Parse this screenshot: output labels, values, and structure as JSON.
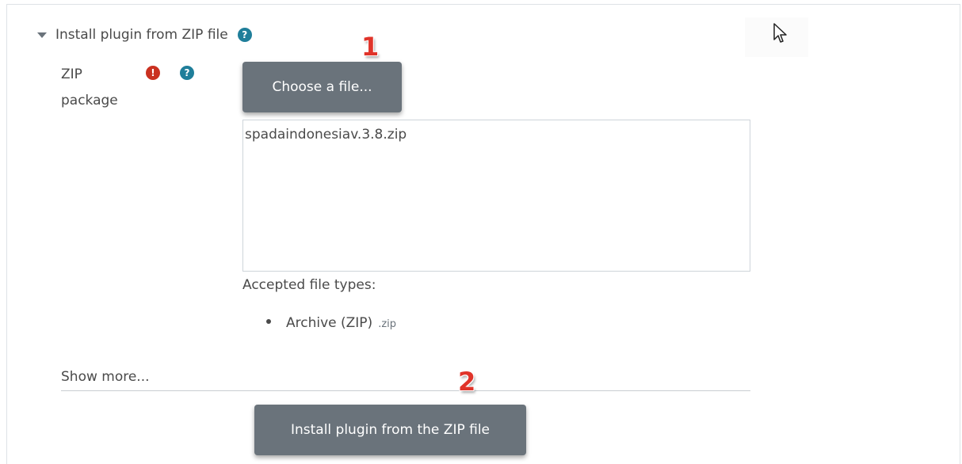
{
  "section": {
    "title": "Install plugin from ZIP file",
    "help_icon": "question-circle-icon"
  },
  "field": {
    "label": "ZIP package",
    "required_icon": "exclamation-circle-icon",
    "help_icon": "question-circle-icon"
  },
  "buttons": {
    "choose_file": "Choose a file...",
    "install": "Install plugin from the ZIP file"
  },
  "annotations": {
    "step1": "1",
    "step2": "2",
    "color": "#e0342a"
  },
  "filepicker": {
    "selected_file": "spadaindonesiav.3.8.zip"
  },
  "accepted": {
    "label": "Accepted file types:",
    "types": [
      {
        "name": "Archive (ZIP)",
        "extension": ".zip"
      }
    ]
  },
  "show_more": "Show more...",
  "colors": {
    "button_bg": "#6a737b",
    "help_icon": "#1f7e9a",
    "required_icon": "#ca3120"
  }
}
